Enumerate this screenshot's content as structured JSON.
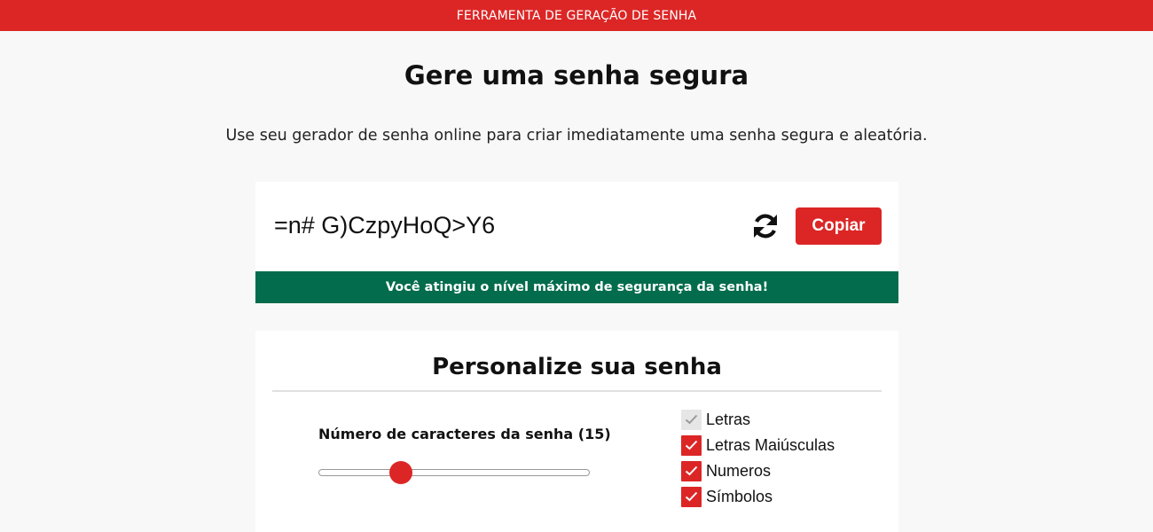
{
  "header": {
    "banner": "FERRAMENTA DE GERAÇÃO DE SENHA"
  },
  "main": {
    "title": "Gere uma senha segura",
    "subtitle": "Use seu gerador de senha online para criar imediatamente uma senha segura e aleatória."
  },
  "generator": {
    "password": "=n# G)CzpyHoQ>Y6",
    "refresh_icon": "refresh-icon",
    "copy_label": "Copiar",
    "strength_message": "Você atingiu o nível máximo de segurança da senha!"
  },
  "customize": {
    "title": "Personalize sua senha",
    "length_label": "Número de caracteres da senha (15)",
    "length_value": 15,
    "length_min": 1,
    "length_max": 50,
    "options": [
      {
        "label": "Letras",
        "checked": true,
        "disabled": true
      },
      {
        "label": "Letras Maiúsculas",
        "checked": true,
        "disabled": false
      },
      {
        "label": "Numeros",
        "checked": true,
        "disabled": false
      },
      {
        "label": "Símbolos",
        "checked": true,
        "disabled": false
      }
    ]
  },
  "colors": {
    "brand_red": "#dc2626",
    "success_green": "#026c4c",
    "page_bg": "#f8f8f8"
  }
}
